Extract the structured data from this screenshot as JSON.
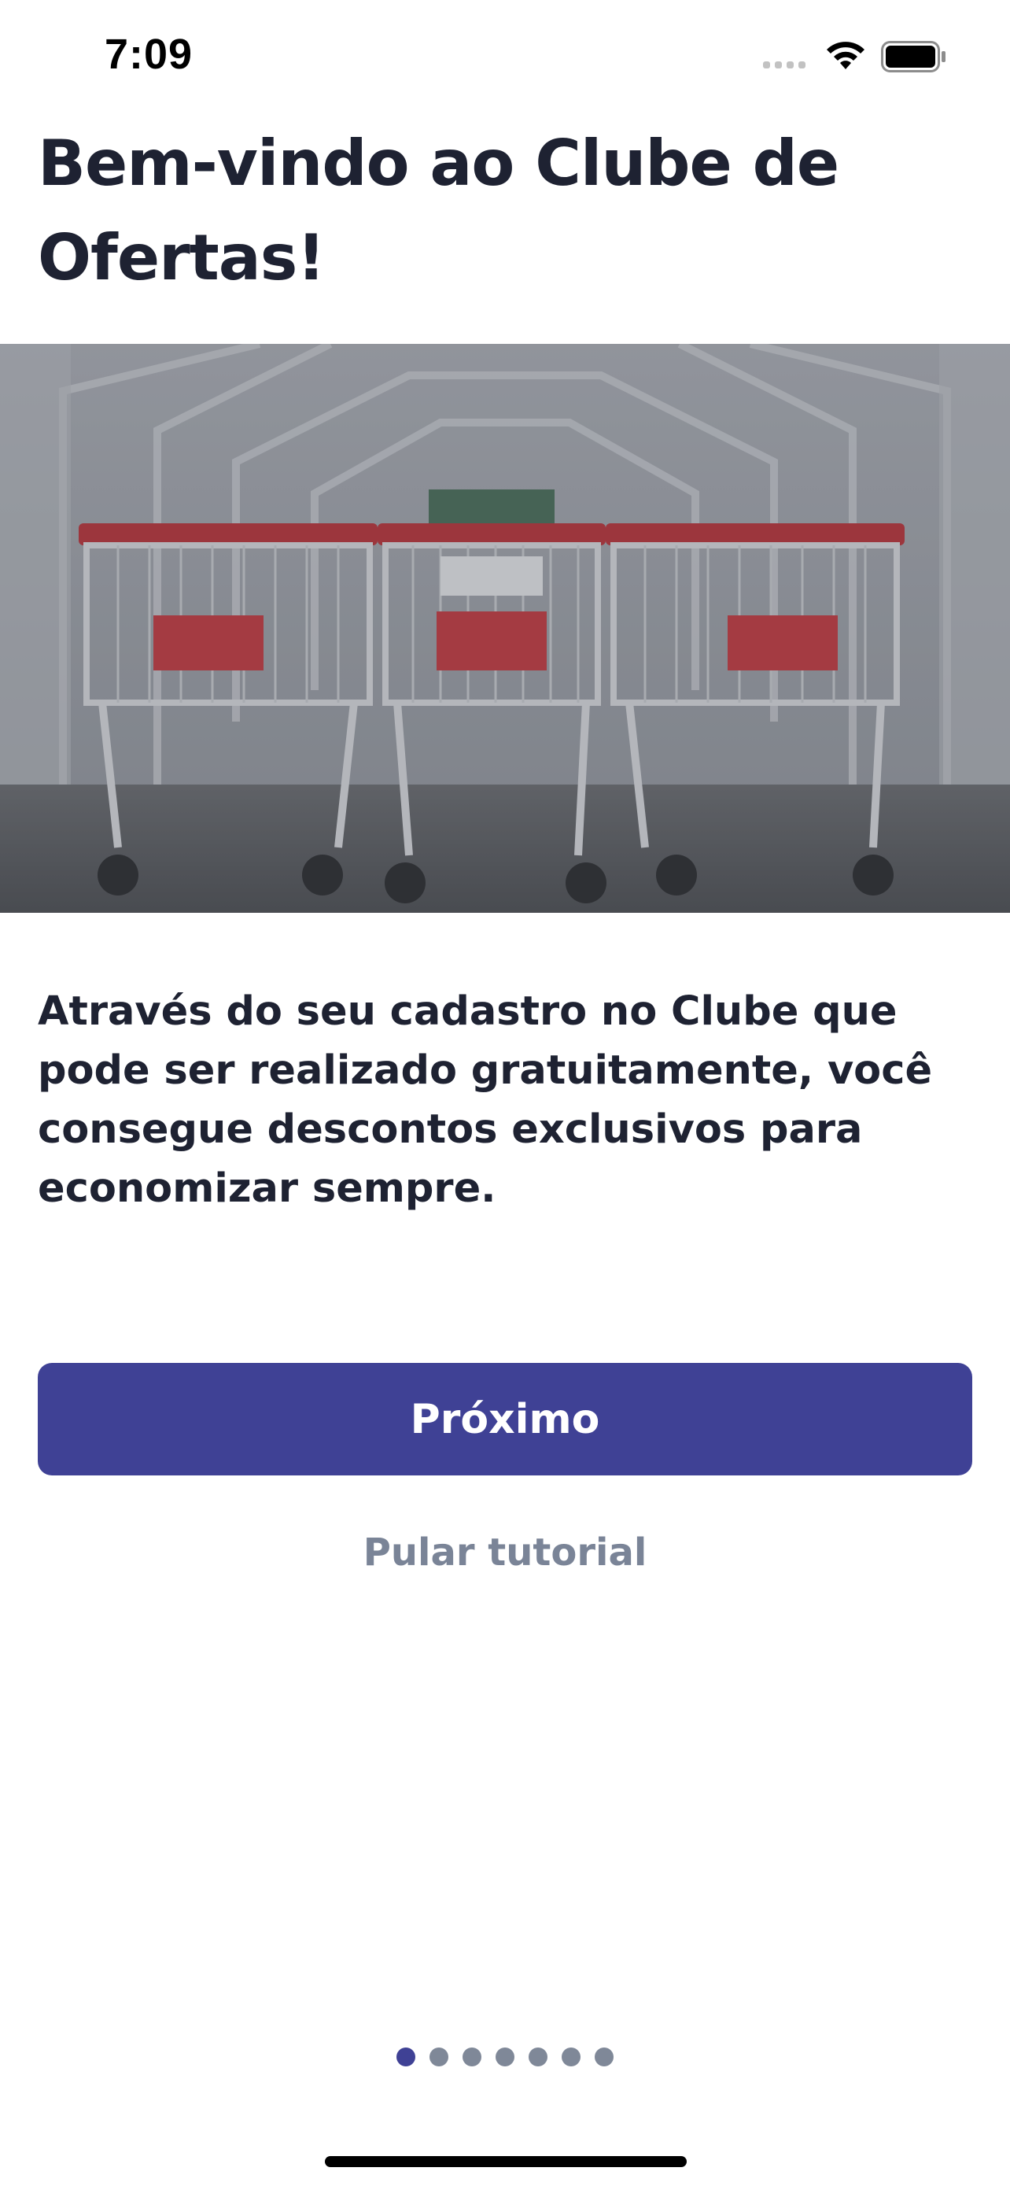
{
  "status_bar": {
    "time": "7:09",
    "icons": [
      "cellular-signal-icon",
      "wifi-icon",
      "battery-icon"
    ]
  },
  "onboarding": {
    "title": "Bem-vindo ao Clube de Ofertas!",
    "hero_image": "shopping-carts-photo",
    "description": "Através do seu cadastro no Clube que pode ser realizado gratuitamente, você consegue descontos exclusivos para economizar sempre.",
    "next_label": "Próximo",
    "skip_label": "Pular tutorial"
  },
  "pagination": {
    "total": 7,
    "current": 1
  },
  "colors": {
    "primary": "#3f4195",
    "text": "#1e2232",
    "muted": "#7a8497",
    "dot_inactive": "#7f8898"
  }
}
